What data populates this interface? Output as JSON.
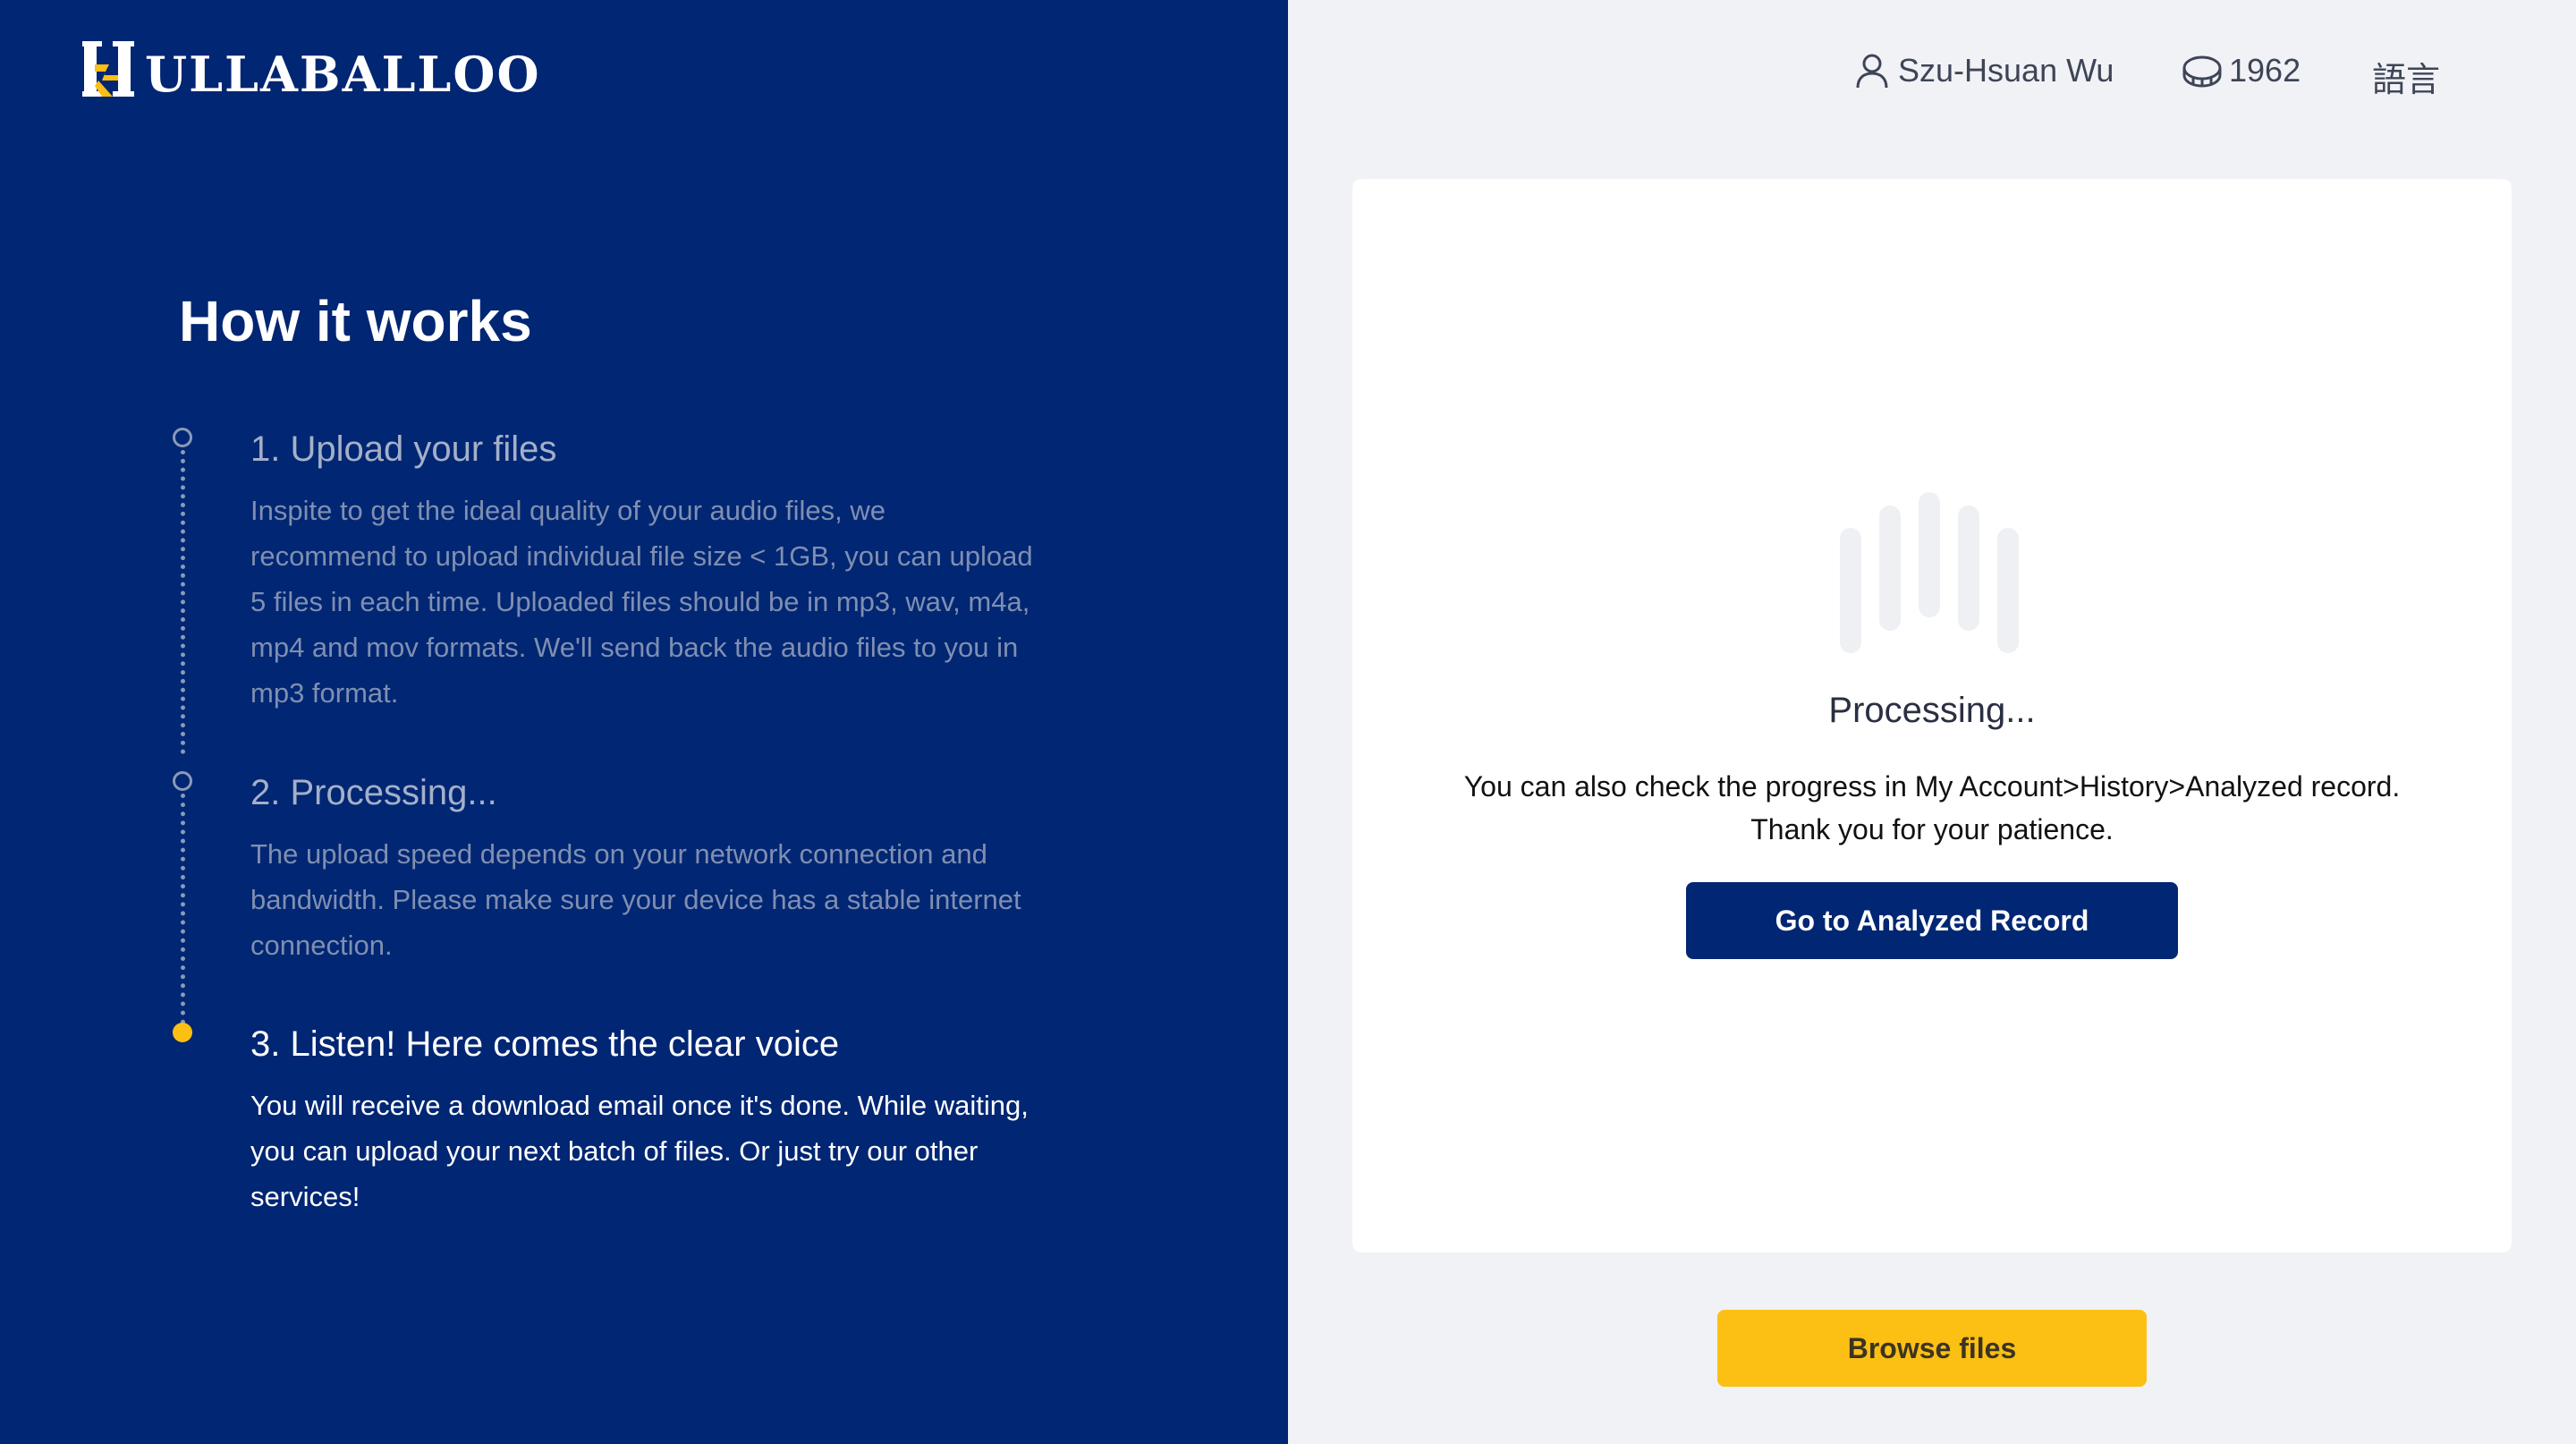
{
  "brand": {
    "logo_text": "ULLABALLOO",
    "logo_initial": "H",
    "primary_color": "#012673",
    "accent_color": "#fcbf14"
  },
  "header": {
    "user_icon": "user-icon",
    "user_name": "Szu-Hsuan Wu",
    "coin_icon": "coin-icon",
    "credits": "1962",
    "language_label": "語言"
  },
  "how_it_works": {
    "title": "How it works",
    "steps": [
      {
        "title": "1. Upload your files",
        "desc_lines": [
          "Inspite to get the ideal quality of your audio files, we",
          "recommend to upload individual file size < 1GB, you can upload",
          "5 files in each time. Uploaded files should be in mp3, wav, m4a,",
          "mp4 and mov formats. We'll send back the audio files to you in",
          "mp3 format."
        ],
        "state": "done"
      },
      {
        "title": "2. Processing...",
        "desc_lines": [
          "The upload speed depends on your network connection and",
          "bandwidth. Please make sure your device has a stable internet",
          "connection."
        ],
        "state": "done"
      },
      {
        "title": "3. Listen! Here comes the clear voice",
        "desc_lines": [
          "You will receive a download email once it's done. While waiting,",
          "you can upload your next batch of files. Or just try our other",
          "services!"
        ],
        "state": "active"
      }
    ]
  },
  "processing_card": {
    "icon": "audio-wave-icon",
    "title": "Processing...",
    "message_line1": "You can also check the progress in My Account>History>Analyzed record.",
    "message_line2": "Thank you for your patience.",
    "record_button_label": "Go to Analyzed Record"
  },
  "footer": {
    "browse_button_label": "Browse files"
  }
}
